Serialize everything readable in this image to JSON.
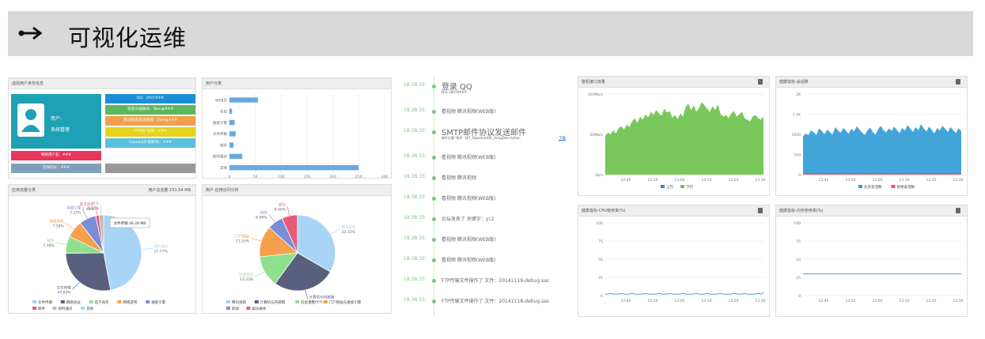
{
  "header": {
    "title": "可视化运维"
  },
  "panel1": {
    "title": "虚拟用户身份信息",
    "user_name": "用户:",
    "user_role": "系统管理",
    "buttons": [
      {
        "label": "QQ：2937###",
        "color": "#1b8fd6"
      },
      {
        "label": "淘宝/天猫账号：Dwn@###",
        "color": "#5cb85c"
      },
      {
        "label": "腾讯微博/新浪微博：Dwn@###",
        "color": "#f0a04b"
      },
      {
        "label": "FTP用户名称：###",
        "color": "#e5d31e"
      },
      {
        "label": "Foxmail(外发邮件)：###",
        "color": "#5bc0de"
      }
    ],
    "bottom_left_label": "网络用户名：###",
    "bottom_left2_label": "在线时长：###"
  },
  "panel2": {
    "title": "用户分类",
    "categories": [
      "WEB页",
      "论坛",
      "搜索引擎",
      "文件传输",
      "邮件",
      "即时通讯",
      "其他"
    ],
    "values": [
      55,
      5,
      10,
      12,
      8,
      25,
      250
    ],
    "xticks": [
      "0",
      "50",
      "100",
      "150",
      "200",
      "250",
      "300"
    ]
  },
  "panel3": {
    "title": "应用流量分类",
    "extra": "用户总流量:151.54 MB",
    "tooltip": "文件传输 46.28 MB",
    "labels": [
      {
        "text": "即时通讯",
        "pct": "27.77%"
      },
      {
        "text": "文件传输",
        "pct": "47.03%"
      },
      {
        "text": "邮件",
        "pct": "7.28%"
      },
      {
        "text": "网络游戏",
        "pct": "7.19%"
      },
      {
        "text": "搜索引擎",
        "pct": "7.25%"
      },
      {
        "text": "电子商务",
        "pct": "1.46%"
      },
      {
        "text": "其他",
        "pct": "1.95%"
      }
    ],
    "legend": [
      "文件传输",
      "网络协议",
      "电子商务",
      "网络游戏",
      "搜索引擎",
      "邮件",
      "即时通讯",
      "其他"
    ],
    "slices": [
      {
        "value": 47.03,
        "color": "#a8d4f5"
      },
      {
        "value": 27.77,
        "color": "#5b5f7e"
      },
      {
        "value": 7.28,
        "color": "#8ee08e"
      },
      {
        "value": 7.25,
        "color": "#f5a04b"
      },
      {
        "value": 7.19,
        "color": "#7a8dd8"
      },
      {
        "value": 1.46,
        "color": "#e85c7a"
      },
      {
        "value": 1.95,
        "color": "#bbbbbb"
      }
    ]
  },
  "panel4": {
    "title": "用户-应用访问分析",
    "labels": [
      {
        "text": "腾讯视频",
        "pct": "33.33%"
      },
      {
        "text": "计算机与内部网",
        "pct": "26.66%"
      },
      {
        "text": "社会生活",
        "pct": "13.33%"
      },
      {
        "text": "门户网站",
        "pct": "13.33%"
      },
      {
        "text": "新闻",
        "pct": "6.66%"
      },
      {
        "text": "娱乐",
        "pct": "6.66%"
      }
    ],
    "legend": [
      "腾讯视频",
      "计算机与内部网",
      "社会生活",
      "门户网站与搜索引擎",
      "新闻",
      "娱乐媒体"
    ],
    "slices": [
      {
        "value": 33.33,
        "color": "#a8d4f5"
      },
      {
        "value": 26.66,
        "color": "#5b5f7e"
      },
      {
        "value": 13.33,
        "color": "#8ee08e"
      },
      {
        "value": 13.33,
        "color": "#f5a04b"
      },
      {
        "value": 6.66,
        "color": "#7a8dd8"
      },
      {
        "value": 6.66,
        "color": "#e85c7a"
      }
    ]
  },
  "timeline": [
    {
      "time": "18:38:33",
      "text": "登录 QQ",
      "sub": "账号:28478###",
      "big": true
    },
    {
      "time": "18:38:33",
      "text": "看视频 腾讯视频(WEB版)",
      "big": false
    },
    {
      "time": "18:38:33",
      "text": "SMTP邮件协议发送邮件",
      "sub": "邮件主题:'附件' 187_SignatureDB_UsingDescription",
      "link": "下载",
      "big": true
    },
    {
      "time": "18:38:33",
      "text": "看视频 腾讯视频(WEB版)",
      "big": false
    },
    {
      "time": "18:38:33",
      "text": "看视频 腾讯视频",
      "big": false
    },
    {
      "time": "18:38:33",
      "text": "看视频 腾讯视频(WEB版)",
      "big": false
    },
    {
      "time": "18:38:33",
      "text": "论坛发表了 关键字：yc2",
      "big": false
    },
    {
      "time": "18:38:33",
      "text": "看视频 腾讯视频(WEB版)",
      "big": false
    },
    {
      "time": "18:38:33",
      "text": "看视频 腾讯视频(WEB版)",
      "big": false
    },
    {
      "time": "18:38:33",
      "text": "FTP传输文件操作了 文件：20141119-debug.sas",
      "big": false
    },
    {
      "time": "18:38:33",
      "text": "FTP传输文件操作了 文件：20141118-debug.sas",
      "big": false
    }
  ],
  "chart_data": [
    {
      "type": "area",
      "title": "整机接口流量",
      "x": [
        "12:40",
        "12:50",
        "13:00",
        "13:10",
        "13:20",
        "13:30"
      ],
      "yticks": [
        "100Mb/s",
        "50Mb/s",
        "0b/s"
      ],
      "ylim": [
        0,
        100
      ],
      "series": [
        {
          "name": "上行",
          "color": "#2e8bc9",
          "values": []
        },
        {
          "name": "下行",
          "color": "#6cc24a",
          "values": [
            48,
            52,
            50,
            55,
            51,
            58,
            60,
            56,
            62,
            59,
            66,
            70,
            64,
            72,
            68,
            75,
            71,
            78,
            74,
            80,
            76,
            73,
            82,
            77,
            79,
            71,
            74,
            69,
            76,
            72,
            84,
            88,
            80,
            86,
            78,
            83,
            90,
            86,
            82,
            78,
            85,
            80,
            87,
            75,
            72,
            74,
            70,
            76,
            79,
            72,
            75,
            78,
            70,
            68,
            66,
            72,
            74,
            70,
            68,
            72
          ]
        }
      ],
      "legend": "bottom"
    },
    {
      "type": "area",
      "title": "健康指标-会话数",
      "x": [
        "12:40",
        "12:50",
        "13:00",
        "13:10",
        "13:20",
        "13:30"
      ],
      "yticks": [
        "2K",
        "1.5K",
        "1000",
        "500",
        "0"
      ],
      "ylim": [
        0,
        2000
      ],
      "series": [
        {
          "name": "允许会话数",
          "color": "#2e9bd6",
          "values": [
            950,
            1020,
            980,
            1100,
            1050,
            980,
            1150,
            1080,
            1000,
            1120,
            1060,
            990,
            1180,
            1100,
            1040,
            1160,
            1090,
            1010,
            1140,
            1070,
            1200,
            1120,
            1050,
            980,
            1100,
            1170,
            1060,
            990,
            1130,
            1210,
            1100,
            1050,
            1150,
            1080,
            1190,
            1110,
            1030,
            1160,
            1090,
            1230,
            1140,
            1060,
            1180,
            1100,
            1250,
            1150,
            1070,
            1190,
            1110,
            1020,
            1160,
            1090,
            1210,
            1140,
            1060,
            1180,
            1100,
            1030,
            1150,
            1080
          ]
        },
        {
          "name": "拒绝会话数",
          "color": "#e8525f",
          "values": [
            30,
            20,
            45,
            25,
            35,
            20,
            40,
            28,
            22,
            38,
            30,
            25,
            42,
            28,
            33,
            20,
            36,
            24,
            40,
            30,
            22,
            35,
            28,
            44,
            26,
            32,
            20,
            38,
            30,
            25,
            40,
            28,
            34,
            22,
            36,
            26,
            42,
            30,
            24,
            38,
            28,
            33,
            20,
            36,
            26,
            40,
            30,
            24,
            38,
            28,
            34,
            22,
            36,
            26,
            42,
            30,
            24,
            38,
            28,
            33
          ]
        }
      ],
      "legend": "bottom"
    },
    {
      "type": "line",
      "title": "健康指标-CPU使用率(%)",
      "x": [
        "12:40",
        "12:50",
        "13:00",
        "13:10",
        "13:20",
        "13:30"
      ],
      "yticks": [
        "100",
        "75",
        "50",
        "25",
        "0"
      ],
      "ylim": [
        0,
        100
      ],
      "series": [
        {
          "name": "CPU",
          "color": "#2e9bd6",
          "values": [
            2,
            2,
            3,
            2,
            2,
            2,
            3,
            2,
            2,
            2,
            3,
            2,
            2,
            2,
            2,
            3,
            2,
            2,
            2,
            2,
            3,
            2,
            2,
            2,
            3,
            2,
            2,
            2,
            2,
            3,
            2,
            2,
            2,
            2,
            3,
            2,
            2,
            2,
            3,
            2,
            2,
            2,
            2,
            3,
            2,
            2,
            2,
            2,
            3,
            2,
            2,
            2,
            3,
            2,
            2,
            2,
            2,
            3,
            2,
            4
          ]
        }
      ]
    },
    {
      "type": "line",
      "title": "健康指标-内存使用率(%)",
      "x": [
        "12:40",
        "12:50",
        "13:00",
        "13:10",
        "13:20",
        "13:30"
      ],
      "yticks": [
        "100",
        "75",
        "50",
        "25",
        "0"
      ],
      "ylim": [
        0,
        100
      ],
      "series": [
        {
          "name": "内存",
          "color": "#2e9bd6",
          "values": [
            30,
            30,
            30,
            30,
            30,
            30,
            30,
            30,
            30,
            30,
            30,
            30,
            30,
            30,
            30,
            30,
            30,
            30,
            30,
            30,
            30,
            30,
            30,
            30,
            30,
            30,
            30,
            30,
            30,
            30
          ]
        }
      ]
    }
  ]
}
